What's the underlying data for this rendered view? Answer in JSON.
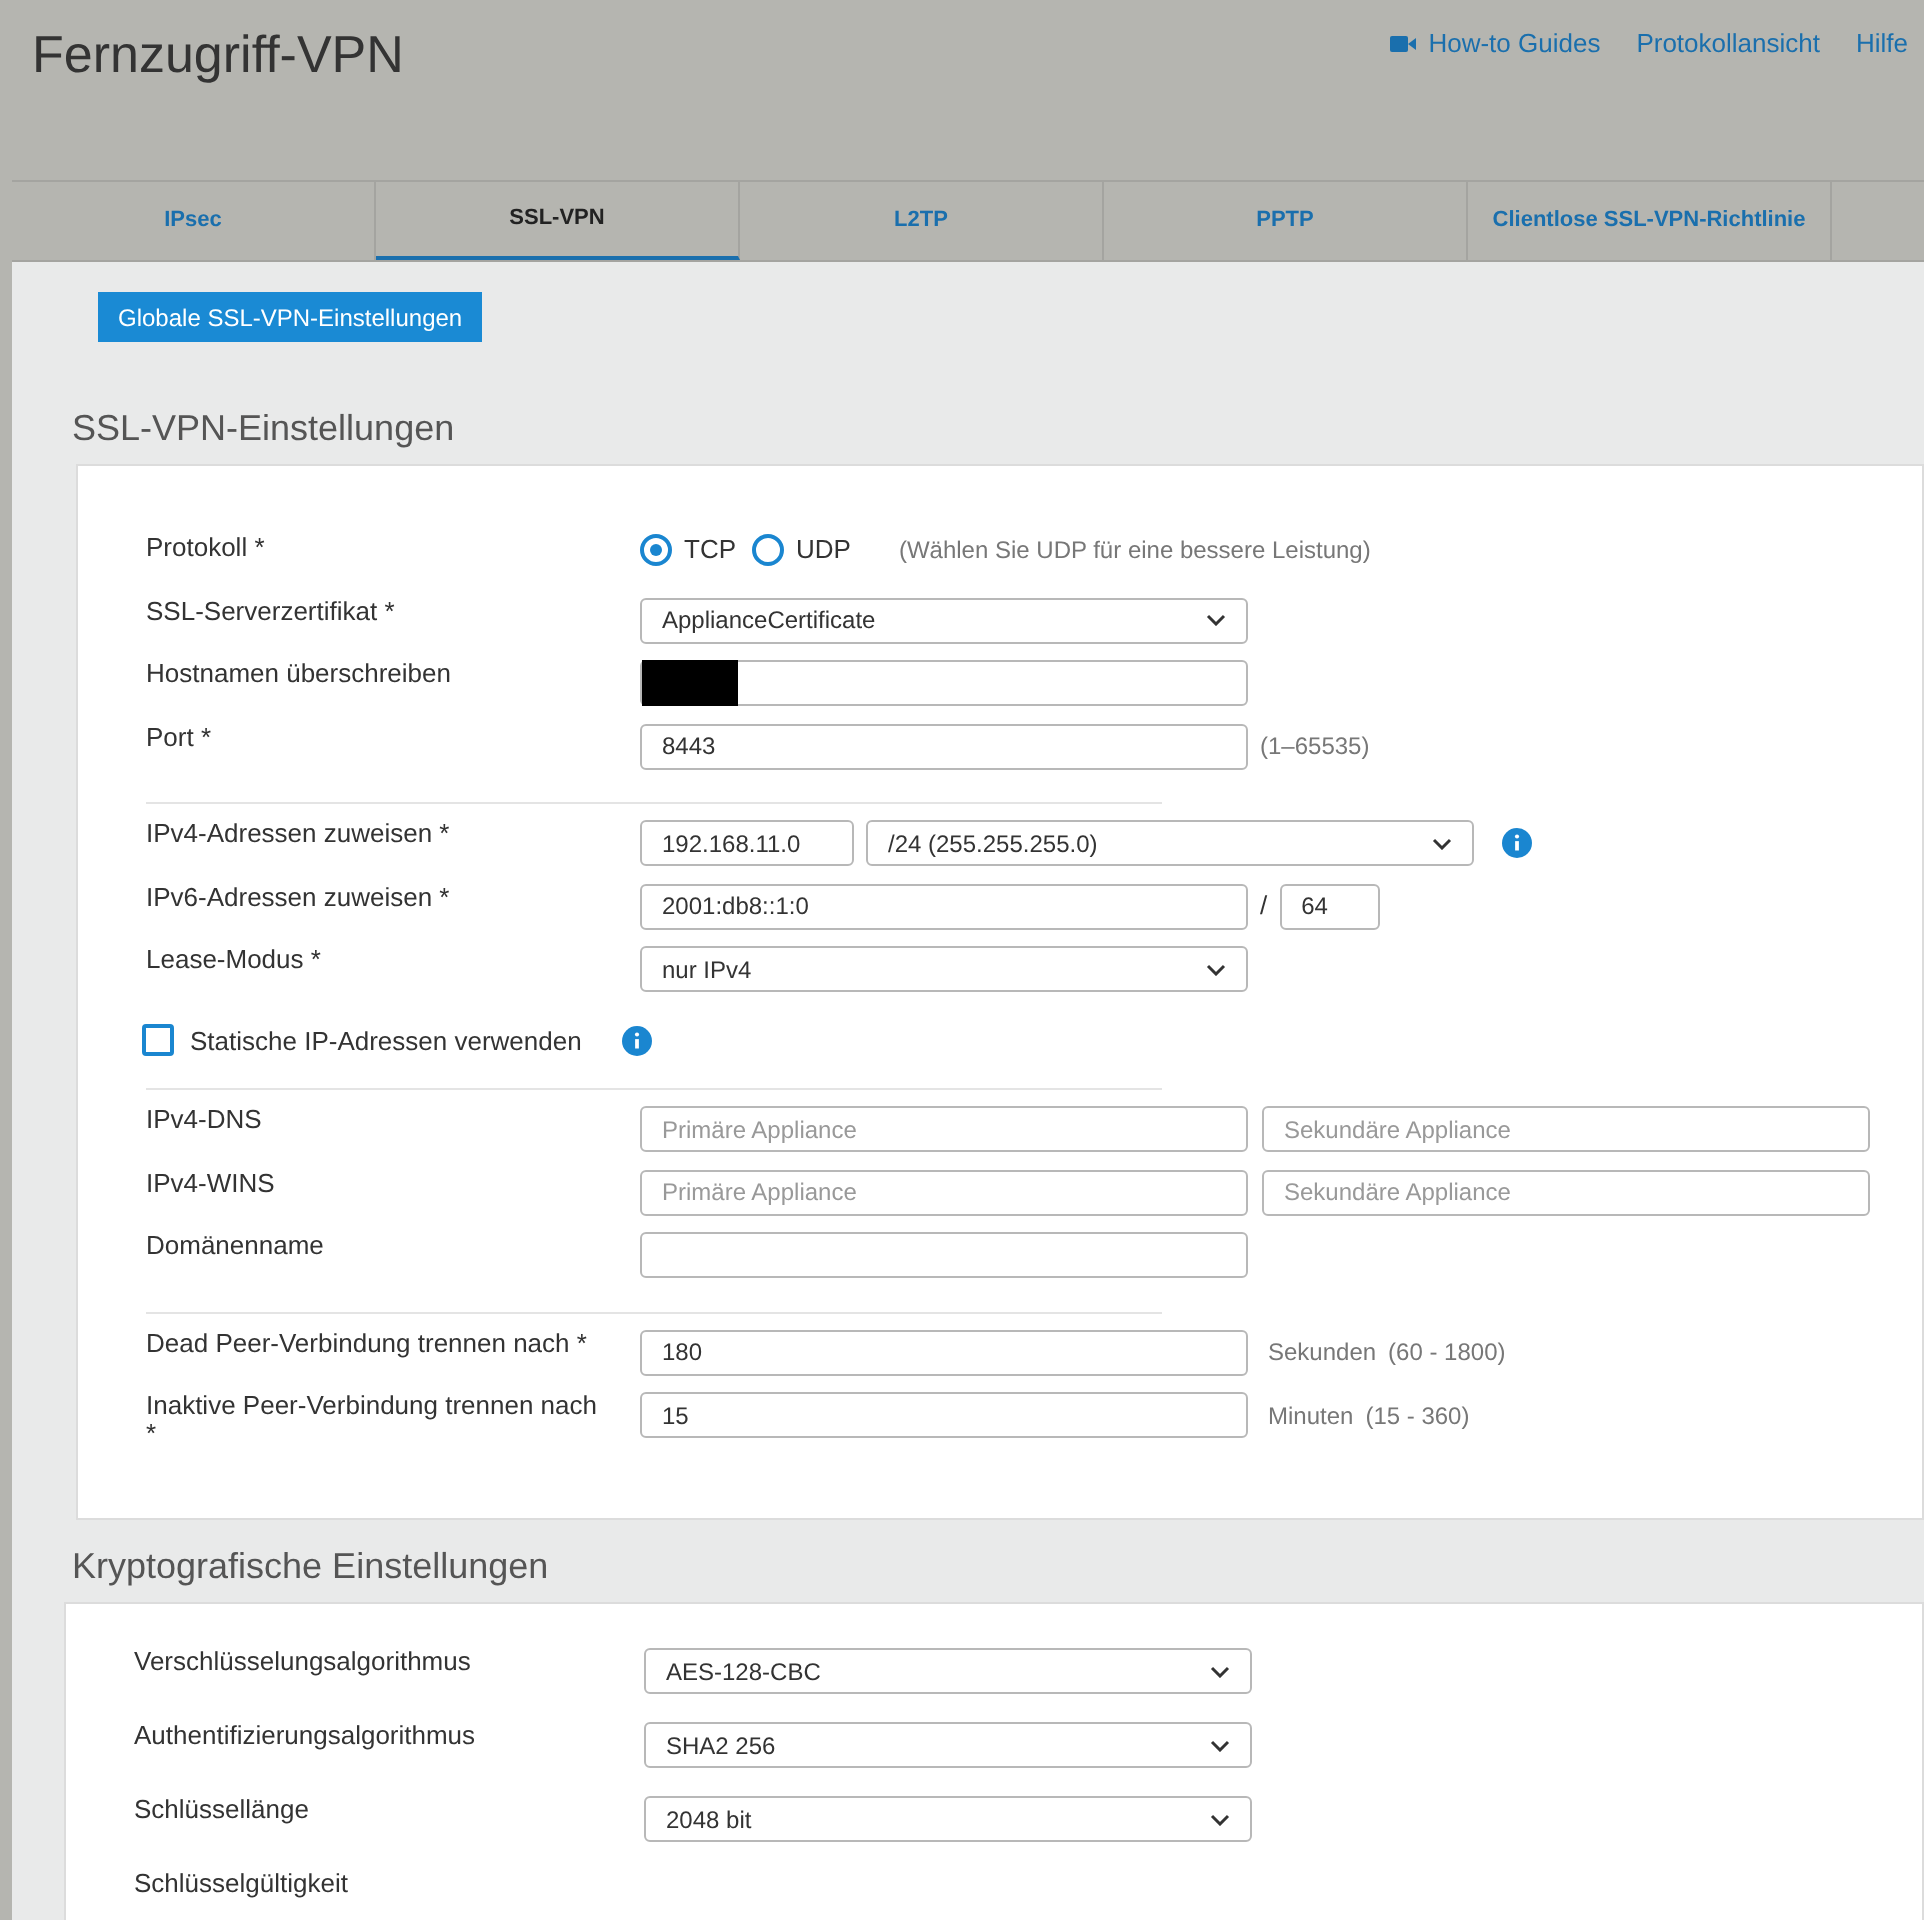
{
  "header": {
    "title": "Fernzugriff-VPN",
    "links": [
      {
        "label": "How-to Guides",
        "icon": true
      },
      {
        "label": "Protokollansicht",
        "icon": false
      },
      {
        "label": "Hilfe",
        "icon": false
      }
    ]
  },
  "tabs": [
    {
      "label": "IPsec",
      "selected": false
    },
    {
      "label": "SSL-VPN",
      "selected": true
    },
    {
      "label": "L2TP",
      "selected": false
    },
    {
      "label": "PPTP",
      "selected": false
    },
    {
      "label": "Clientlose SSL-VPN-Richtlinie",
      "selected": false
    }
  ],
  "global_button": "Globale SSL-VPN-Einstellungen",
  "sections": [
    {
      "title": "SSL-VPN-Einstellungen",
      "rows": [
        {
          "kind": "radio",
          "label": "Protokoll *",
          "options": [
            {
              "label": "TCP",
              "selected": true
            },
            {
              "label": "UDP",
              "selected": false
            }
          ],
          "hint": "(Wählen Sie UDP für eine bessere Leistung)"
        },
        {
          "kind": "select",
          "label": "SSL-Serverzertifikat *",
          "value": "ApplianceCertificate"
        },
        {
          "kind": "text",
          "label": "Hostnamen überschreiben",
          "redacted": true
        },
        {
          "kind": "text",
          "label": "Port *",
          "value": "8443",
          "hint": "(1–65535)"
        },
        {
          "kind": "divider"
        },
        {
          "kind": "ip_select",
          "label": "IPv4-Adressen zuweisen *",
          "value": "192.168.11.0",
          "select": "/24 (255.255.255.0)"
        },
        {
          "kind": "ip_prefix",
          "label": "IPv6-Adressen zuweisen *",
          "value": "2001:db8::1:0",
          "separator": "/",
          "prefix": "64"
        },
        {
          "kind": "select",
          "label": "Lease-Modus *",
          "value": "nur IPv4"
        },
        {
          "kind": "checkbox",
          "label": "Statische IP-Adressen verwenden",
          "checked": false
        },
        {
          "kind": "divider"
        },
        {
          "kind": "pair",
          "label": "IPv4-DNS",
          "placeholders": [
            "Primäre Appliance",
            "Sekundäre Appliance"
          ]
        },
        {
          "kind": "pair",
          "label": "IPv4-WINS",
          "placeholders": [
            "Primäre Appliance",
            "Sekundäre Appliance"
          ]
        },
        {
          "kind": "text",
          "label": "Domänenname"
        },
        {
          "kind": "divider"
        },
        {
          "kind": "text",
          "label": "Dead Peer-Verbindung trennen nach *",
          "value": "180",
          "unit": "Sekunden",
          "hint": "(60 - 1800)"
        },
        {
          "kind": "text",
          "label": "Inaktive Peer-Verbindung trennen nach *",
          "value": "15",
          "unit": "Minuten",
          "hint": "(15 - 360)"
        }
      ]
    },
    {
      "title": "Kryptografische Einstellungen",
      "rows": [
        {
          "kind": "select",
          "label": "Verschlüsselungsalgorithmus",
          "value": "AES-128-CBC"
        },
        {
          "kind": "select",
          "label": "Authentifizierungsalgorithmus",
          "value": "SHA2 256"
        },
        {
          "kind": "select",
          "label": "Schlüssellänge",
          "value": "2048 bit"
        },
        {
          "kind": "label_only",
          "label": "Schlüsselgültigkeit"
        }
      ]
    }
  ]
}
